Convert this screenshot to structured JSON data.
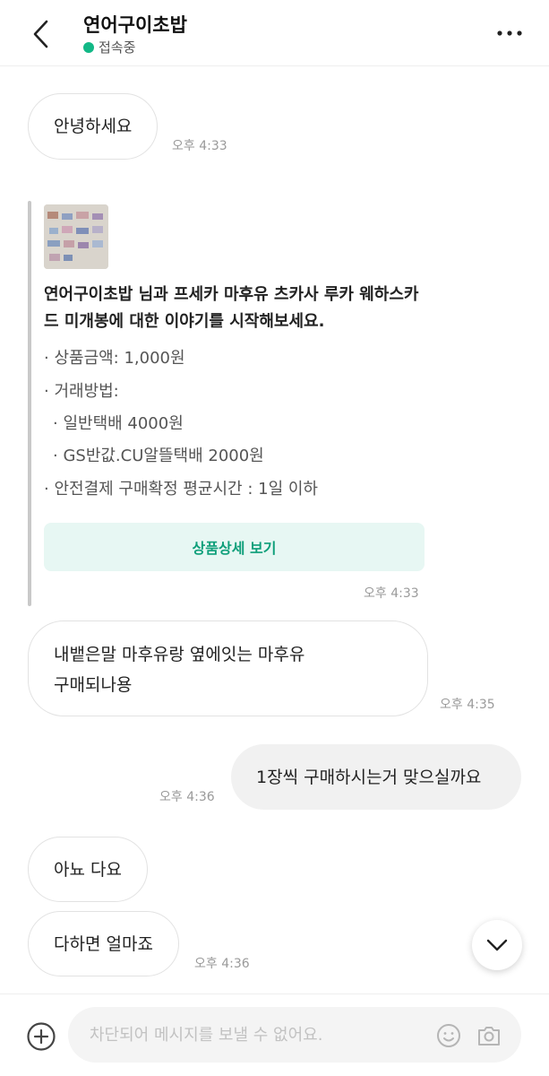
{
  "header": {
    "title": "연어구이초밥",
    "status": "접속중",
    "status_color": "#12b886"
  },
  "messages": {
    "m1": {
      "text": "안녕하세요",
      "time": "오후 4:33"
    },
    "card": {
      "title": "연어구이초밥 님과 프세카 마후유 츠카사 루카 웨하스카드 미개봉에 대한 이야기를 시작해보세요.",
      "price": "· 상품금액: 1,000원",
      "method_label": "· 거래방법:",
      "method_1": "· 일반택배 4000원",
      "method_2": "· GS반값.CU알뜰택배 2000원",
      "safe_pay": "· 안전결제 구매확정 평균시간 : 1일 이하",
      "detail_button": "상품상세 보기",
      "time": "오후 4:33",
      "accent_color": "#0f9f7a"
    },
    "m2": {
      "line1": "내뱉은말 마후유랑 옆에잇는 마후유",
      "line2": "구매되나용",
      "time": "오후 4:35"
    },
    "m3": {
      "text": "1장씩 구매하시는거 맞으실까요",
      "time": "오후 4:36"
    },
    "m4": {
      "text": "아뇨 다요"
    },
    "m5": {
      "text": "다하면 얼마죠",
      "time": "오후 4:36"
    }
  },
  "composer": {
    "placeholder": "차단되어 메시지를 보낼 수 없어요."
  },
  "icons": {
    "back": "chevron-left-icon",
    "more": "more-dots-icon",
    "scroll_down": "chevron-down-icon",
    "add": "plus-circle-icon",
    "emoji": "smiley-icon",
    "camera": "camera-icon"
  }
}
